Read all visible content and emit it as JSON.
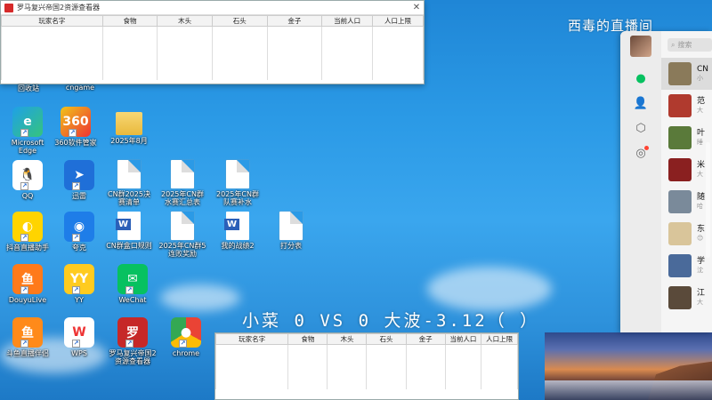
{
  "resource_window": {
    "title": "罗马复兴帝国2资源查看器",
    "columns": [
      "玩家名字",
      "食物",
      "木头",
      "石头",
      "金子",
      "当前人口",
      "人口上限"
    ]
  },
  "desktop_icons_top": [
    "回收站",
    "cngame"
  ],
  "desktop_icons": [
    {
      "label": "Microsoft Edge",
      "kind": "edge"
    },
    {
      "label": "360软件管家",
      "kind": "s360"
    },
    {
      "label": "2025年8月",
      "kind": "folder"
    },
    {
      "label": "QQ",
      "kind": "qq"
    },
    {
      "label": "迅雷",
      "kind": "xunlei"
    },
    {
      "label": "CN群2025决赛清单",
      "kind": "file"
    },
    {
      "label": "2025年CN群水赛汇总表",
      "kind": "file"
    },
    {
      "label": "2025年CN群队赛补水",
      "kind": "file"
    },
    {
      "label": "抖音直播助手",
      "kind": "douyin"
    },
    {
      "label": "夸克",
      "kind": "quark"
    },
    {
      "label": "CN群盒口规则",
      "kind": "word"
    },
    {
      "label": "2025年CN群5连败奖励",
      "kind": "file"
    },
    {
      "label": "我的战绩2",
      "kind": "word"
    },
    {
      "label": "打分表",
      "kind": "file"
    },
    {
      "label": "DouyuLive",
      "kind": "douyu"
    },
    {
      "label": "YY",
      "kind": "yy"
    },
    {
      "label": "WeChat",
      "kind": "wechat"
    },
    {
      "label": "斗鱼直播伴侣",
      "kind": "douyu2"
    },
    {
      "label": "WPS",
      "kind": "wps"
    },
    {
      "label": "罗马复兴帝国2资源查看器",
      "kind": "roma"
    },
    {
      "label": "chrome",
      "kind": "chrome"
    }
  ],
  "overlay": {
    "top_right_text": "西毒的直播间",
    "match_title": "小菜 0 VS 0 大波-3.12（ ）"
  },
  "chat": {
    "search_placeholder": "搜索",
    "rows": [
      {
        "name": "CN",
        "sub": "小"
      },
      {
        "name": "范",
        "sub": "大"
      },
      {
        "name": "叶",
        "sub": "睡"
      },
      {
        "name": "米",
        "sub": "大"
      },
      {
        "name": "随",
        "sub": "哈"
      },
      {
        "name": "东",
        "sub": "😊"
      },
      {
        "name": "学",
        "sub": "沈"
      },
      {
        "name": "江",
        "sub": "大"
      }
    ]
  },
  "colors": {
    "wechat_green": "#07c160",
    "desktop_blue": "#2b9ae6"
  }
}
